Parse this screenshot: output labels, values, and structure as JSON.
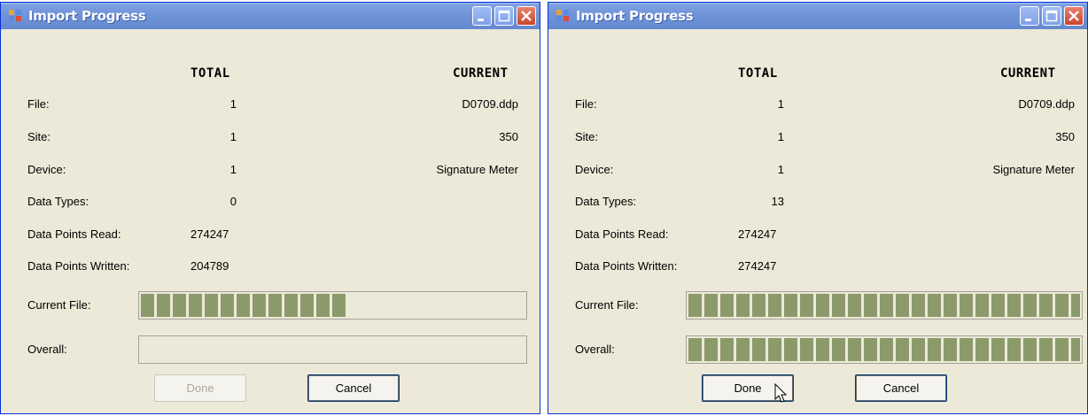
{
  "windows": [
    {
      "title": "Import Progress",
      "headers": {
        "total": "TOTAL",
        "current": "CURRENT"
      },
      "rows": [
        {
          "label": "File:",
          "total": "1",
          "current": "D0709.ddp"
        },
        {
          "label": "Site:",
          "total": "1",
          "current": "350"
        },
        {
          "label": "Device:",
          "total": "1",
          "current": "Signature Meter"
        },
        {
          "label": "Data Types:",
          "total": "0"
        },
        {
          "label": "Data Points Read:",
          "total": "274247"
        },
        {
          "label": "Data Points Written:",
          "total": "204789"
        }
      ],
      "progress": {
        "current_label": "Current File:",
        "current_fraction": 0.58,
        "overall_label": "Overall:",
        "overall_fraction": 0
      },
      "buttons": {
        "done": "Done",
        "done_enabled": false,
        "cancel": "Cancel"
      }
    },
    {
      "title": "Import Progress",
      "headers": {
        "total": "TOTAL",
        "current": "CURRENT"
      },
      "rows": [
        {
          "label": "File:",
          "total": "1",
          "current": "D0709.ddp"
        },
        {
          "label": "Site:",
          "total": "1",
          "current": "350"
        },
        {
          "label": "Device:",
          "total": "1",
          "current": "Signature Meter"
        },
        {
          "label": "Data Types:",
          "total": "13"
        },
        {
          "label": "Data Points Read:",
          "total": "274247"
        },
        {
          "label": "Data Points Written:",
          "total": "274247"
        }
      ],
      "progress": {
        "current_label": "Current File:",
        "current_fraction": 1,
        "overall_label": "Overall:",
        "overall_fraction": 1
      },
      "buttons": {
        "done": "Done",
        "done_enabled": true,
        "cancel": "Cancel"
      }
    }
  ],
  "icons": {
    "window_icon": "app-window-icon",
    "minimize": "minimize-icon",
    "maximize": "maximize-icon",
    "close": "close-icon",
    "cursor": "mouse-pointer-icon"
  },
  "colors": {
    "titlebar": "#6f93d8",
    "dialog_bg": "#ece9d8",
    "progress_fill": "#8b9a6b",
    "close_button": "#c8462b"
  }
}
